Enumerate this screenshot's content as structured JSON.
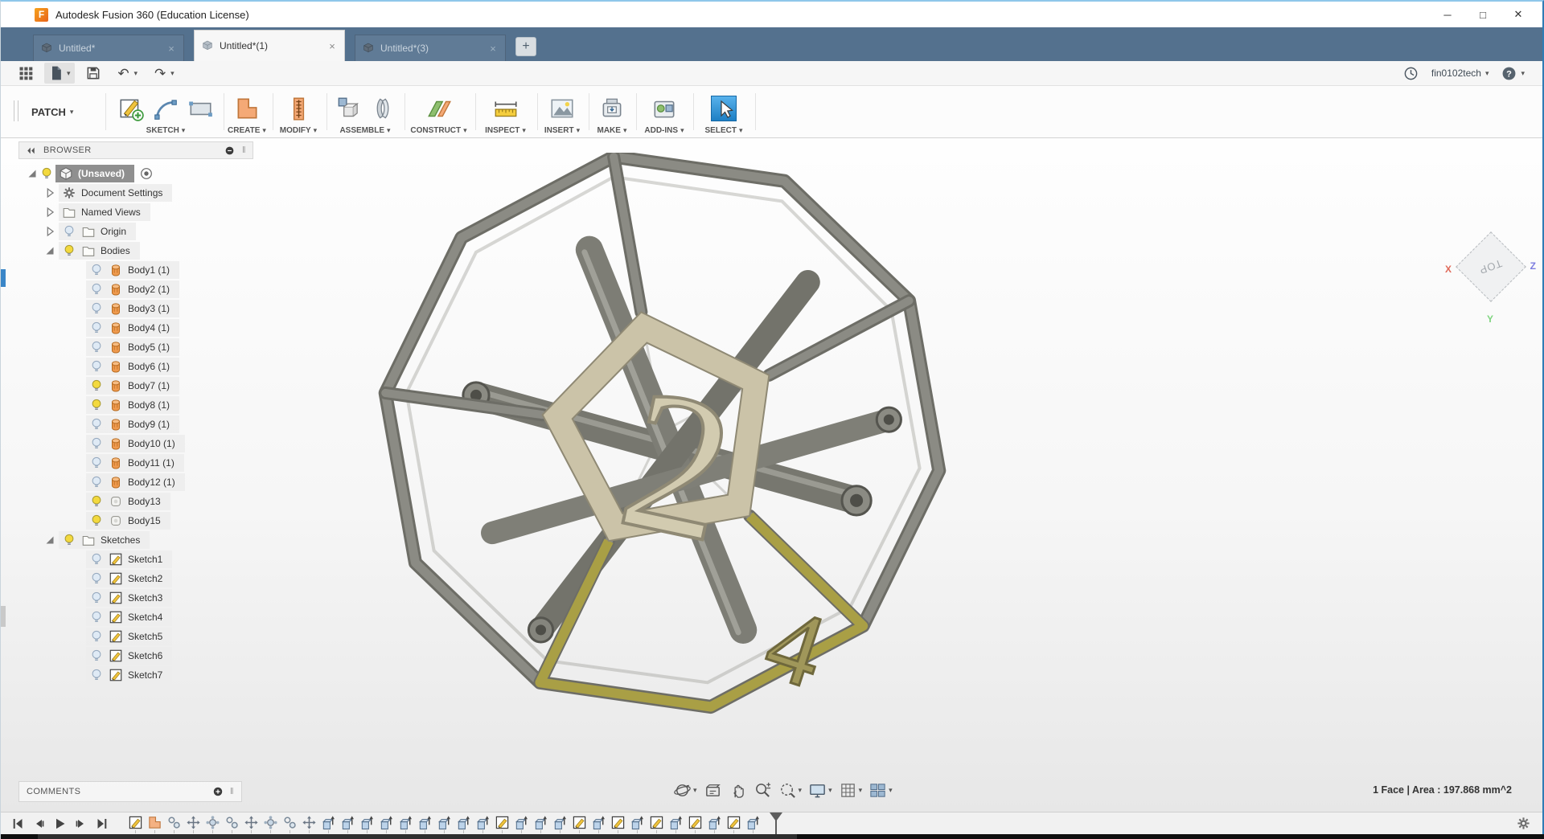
{
  "window": {
    "title": "Autodesk Fusion 360 (Education License)",
    "logo": "F",
    "controls": {
      "minimize": "─",
      "maximize": "□",
      "close": "✕"
    }
  },
  "tabs": {
    "items": [
      {
        "label": "Untitled*",
        "active": false
      },
      {
        "label": "Untitled*(1)",
        "active": true
      },
      {
        "label": "Untitled*(3)",
        "active": false
      }
    ],
    "close_glyph": "×",
    "new_tab": "+"
  },
  "qat": {
    "buttons": [
      {
        "name": "apps-grid",
        "caret": false,
        "pressed": false
      },
      {
        "name": "file-menu",
        "caret": true,
        "pressed": true
      },
      {
        "name": "save",
        "caret": false,
        "pressed": false
      },
      {
        "name": "undo",
        "caret": true,
        "pressed": false
      },
      {
        "name": "redo",
        "caret": true,
        "pressed": false
      }
    ],
    "account": {
      "clock": "clock",
      "user": "fin0102tech",
      "help": "help"
    }
  },
  "ribbon": {
    "patch_label": "PATCH",
    "groups": [
      {
        "label": "SKETCH",
        "icons": [
          "create-sketch",
          "arc",
          "rectangle"
        ],
        "selected": false
      },
      {
        "label": "CREATE",
        "icons": [
          "patch-create"
        ],
        "selected": false
      },
      {
        "label": "MODIFY",
        "icons": [
          "modify-ruler"
        ],
        "selected": false
      },
      {
        "label": "ASSEMBLE",
        "icons": [
          "assemble-cubes",
          "joint"
        ],
        "selected": false
      },
      {
        "label": "CONSTRUCT",
        "icons": [
          "construct-planes"
        ],
        "selected": false
      },
      {
        "label": "INSPECT",
        "icons": [
          "measure"
        ],
        "selected": false
      },
      {
        "label": "INSERT",
        "icons": [
          "insert-image"
        ],
        "selected": false
      },
      {
        "label": "MAKE",
        "icons": [
          "make-print"
        ],
        "selected": false
      },
      {
        "label": "ADD-INS",
        "icons": [
          "add-ins"
        ],
        "selected": false
      },
      {
        "label": "SELECT",
        "icons": [
          "select-cursor"
        ],
        "selected": true
      }
    ]
  },
  "browser": {
    "header": "BROWSER",
    "rows": [
      {
        "depth": 0,
        "arrow": "exp",
        "bulb": "on",
        "icon": "doc-cube",
        "label": "(Unsaved)",
        "selected": true,
        "activate": true
      },
      {
        "depth": 1,
        "arrow": "col",
        "bulb": "",
        "icon": "gear",
        "label": "Document Settings"
      },
      {
        "depth": 1,
        "arrow": "col",
        "bulb": "",
        "icon": "folder",
        "label": "Named Views"
      },
      {
        "depth": 1,
        "arrow": "col",
        "bulb": "off",
        "icon": "folder",
        "label": "Origin"
      },
      {
        "depth": 1,
        "arrow": "exp",
        "bulb": "on",
        "icon": "folder",
        "label": "Bodies"
      },
      {
        "depth": 2,
        "arrow": "",
        "bulb": "off",
        "icon": "body",
        "label": "Body1 (1)"
      },
      {
        "depth": 2,
        "arrow": "",
        "bulb": "off",
        "icon": "body",
        "label": "Body2 (1)"
      },
      {
        "depth": 2,
        "arrow": "",
        "bulb": "off",
        "icon": "body",
        "label": "Body3 (1)"
      },
      {
        "depth": 2,
        "arrow": "",
        "bulb": "off",
        "icon": "body",
        "label": "Body4 (1)"
      },
      {
        "depth": 2,
        "arrow": "",
        "bulb": "off",
        "icon": "body",
        "label": "Body5 (1)"
      },
      {
        "depth": 2,
        "arrow": "",
        "bulb": "off",
        "icon": "body",
        "label": "Body6 (1)"
      },
      {
        "depth": 2,
        "arrow": "",
        "bulb": "on",
        "icon": "body",
        "label": "Body7 (1)"
      },
      {
        "depth": 2,
        "arrow": "",
        "bulb": "on",
        "icon": "body",
        "label": "Body8 (1)"
      },
      {
        "depth": 2,
        "arrow": "",
        "bulb": "off",
        "icon": "body",
        "label": "Body9 (1)"
      },
      {
        "depth": 2,
        "arrow": "",
        "bulb": "off",
        "icon": "body",
        "label": "Body10 (1)"
      },
      {
        "depth": 2,
        "arrow": "",
        "bulb": "off",
        "icon": "body",
        "label": "Body11 (1)"
      },
      {
        "depth": 2,
        "arrow": "",
        "bulb": "off",
        "icon": "body",
        "label": "Body12 (1)"
      },
      {
        "depth": 2,
        "arrow": "",
        "bulb": "on",
        "icon": "surface",
        "label": "Body13"
      },
      {
        "depth": 2,
        "arrow": "",
        "bulb": "on",
        "icon": "surface",
        "label": "Body15"
      },
      {
        "depth": 1,
        "arrow": "exp",
        "bulb": "on",
        "icon": "folder",
        "label": "Sketches"
      },
      {
        "depth": 2,
        "arrow": "",
        "bulb": "off",
        "icon": "sketch",
        "label": "Sketch1"
      },
      {
        "depth": 2,
        "arrow": "",
        "bulb": "off",
        "icon": "sketch",
        "label": "Sketch2"
      },
      {
        "depth": 2,
        "arrow": "",
        "bulb": "off",
        "icon": "sketch",
        "label": "Sketch3"
      },
      {
        "depth": 2,
        "arrow": "",
        "bulb": "off",
        "icon": "sketch",
        "label": "Sketch4"
      },
      {
        "depth": 2,
        "arrow": "",
        "bulb": "off",
        "icon": "sketch",
        "label": "Sketch5"
      },
      {
        "depth": 2,
        "arrow": "",
        "bulb": "off",
        "icon": "sketch",
        "label": "Sketch6"
      },
      {
        "depth": 2,
        "arrow": "",
        "bulb": "off",
        "icon": "sketch",
        "label": "Sketch7"
      }
    ]
  },
  "viewcube": {
    "top": "TOP",
    "x": "X",
    "y": "Y",
    "z": "Z"
  },
  "model": {
    "numbers": {
      "center": "2",
      "bottom": "4"
    }
  },
  "comments": {
    "label": "COMMENTS"
  },
  "navbar": {
    "buttons": [
      {
        "name": "orbit",
        "caret": true
      },
      {
        "name": "look-at",
        "caret": false
      },
      {
        "name": "pan",
        "caret": false
      },
      {
        "name": "zoom",
        "caret": false
      },
      {
        "name": "zoom-window",
        "caret": true
      },
      {
        "name": "display-settings",
        "caret": true
      },
      {
        "name": "grid-display",
        "caret": true
      },
      {
        "name": "viewports",
        "caret": true
      }
    ]
  },
  "status": {
    "text": "1 Face | Area : 197.868 mm^2"
  },
  "timeline": {
    "playback": [
      "skip-start",
      "step-back",
      "play",
      "step-forward",
      "skip-end"
    ],
    "items": [
      "sketch",
      "patch",
      "joint",
      "move",
      "orient",
      "joint",
      "move",
      "orient",
      "joint",
      "move",
      "extrude",
      "extrude",
      "extrude",
      "extrude",
      "extrude",
      "extrude",
      "extrude",
      "extrude",
      "extrude",
      "sketch",
      "extrude",
      "extrude",
      "extrude",
      "sketch",
      "extrude",
      "sketch",
      "extrude",
      "sketch",
      "extrude",
      "sketch",
      "extrude",
      "sketch",
      "extrude"
    ]
  },
  "colors": {
    "accent_blue": "#1e7fc4",
    "tabstrip": "#54718e",
    "body_orange": "#ef9a4e",
    "bulb_on": "#f3d93e",
    "frame_gray": "#82827b",
    "face_tan": "#cbc3a8",
    "face_olive": "#a99f45"
  }
}
